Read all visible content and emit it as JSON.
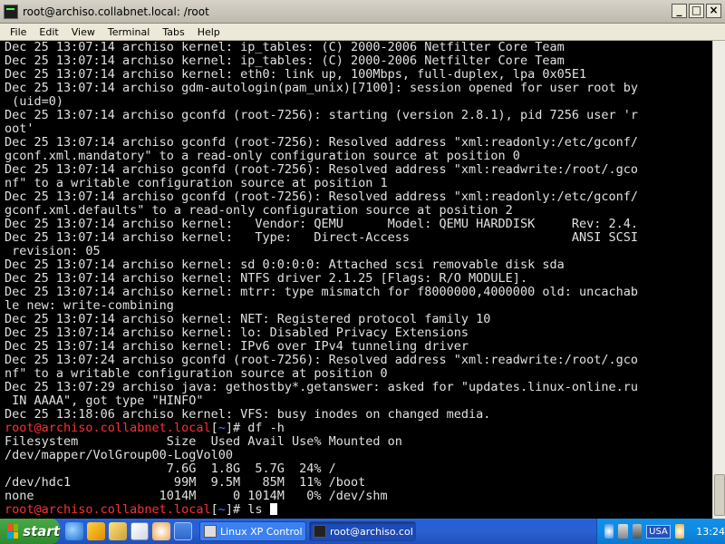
{
  "window": {
    "title": "root@archiso.collabnet.local: /root",
    "buttons": [
      "_",
      "□",
      "×"
    ]
  },
  "menu": [
    "File",
    "Edit",
    "View",
    "Terminal",
    "Tabs",
    "Help"
  ],
  "terminal": {
    "lines": [
      "Dec 25 13:07:14 archiso kernel: ip_tables: (C) 2000-2006 Netfilter Core Team",
      "Dec 25 13:07:14 archiso kernel: ip_tables: (C) 2000-2006 Netfilter Core Team",
      "Dec 25 13:07:14 archiso kernel: eth0: link up, 100Mbps, full-duplex, lpa 0x05E1",
      "Dec 25 13:07:14 archiso gdm-autologin(pam_unix)[7100]: session opened for user root by",
      " (uid=0)",
      "Dec 25 13:07:14 archiso gconfd (root-7256): starting (version 2.8.1), pid 7256 user 'r",
      "oot'",
      "Dec 25 13:07:14 archiso gconfd (root-7256): Resolved address \"xml:readonly:/etc/gconf/",
      "gconf.xml.mandatory\" to a read-only configuration source at position 0",
      "Dec 25 13:07:14 archiso gconfd (root-7256): Resolved address \"xml:readwrite:/root/.gco",
      "nf\" to a writable configuration source at position 1",
      "Dec 25 13:07:14 archiso gconfd (root-7256): Resolved address \"xml:readonly:/etc/gconf/",
      "gconf.xml.defaults\" to a read-only configuration source at position 2",
      "Dec 25 13:07:14 archiso kernel:   Vendor: QEMU      Model: QEMU HARDDISK     Rev: 2.4.",
      "Dec 25 13:07:14 archiso kernel:   Type:   Direct-Access                      ANSI SCSI",
      " revision: 05",
      "Dec 25 13:07:14 archiso kernel: sd 0:0:0:0: Attached scsi removable disk sda",
      "Dec 25 13:07:14 archiso kernel: NTFS driver 2.1.25 [Flags: R/O MODULE].",
      "Dec 25 13:07:14 archiso kernel: mtrr: type mismatch for f8000000,4000000 old: uncachab",
      "le new: write-combining",
      "Dec 25 13:07:14 archiso kernel: NET: Registered protocol family 10",
      "Dec 25 13:07:14 archiso kernel: lo: Disabled Privacy Extensions",
      "Dec 25 13:07:14 archiso kernel: IPv6 over IPv4 tunneling driver",
      "Dec 25 13:07:24 archiso gconfd (root-7256): Resolved address \"xml:readwrite:/root/.gco",
      "nf\" to a writable configuration source at position 0",
      "Dec 25 13:07:29 archiso java: gethostby*.getanswer: asked for \"updates.linux-online.ru",
      " IN AAAA\", got type \"HINFO\"",
      "Dec 25 13:18:06 archiso kernel: VFS: busy inodes on changed media."
    ],
    "prompt_host": "root@archiso.collabnet.local",
    "prompt_path": "~",
    "command1": "df -h",
    "df_output": [
      "Filesystem            Size  Used Avail Use% Mounted on",
      "/dev/mapper/VolGroup00-LogVol00",
      "                      7.6G  1.8G  5.7G  24% /",
      "/dev/hdc1              99M  9.5M   85M  11% /boot",
      "none                 1014M     0 1014M   0% /dev/shm"
    ],
    "command2": "ls "
  },
  "taskbar": {
    "start_label": "start",
    "tasks": [
      "Linux XP Control",
      "root@archiso.col"
    ],
    "language": "USA",
    "clock": "13:24"
  }
}
